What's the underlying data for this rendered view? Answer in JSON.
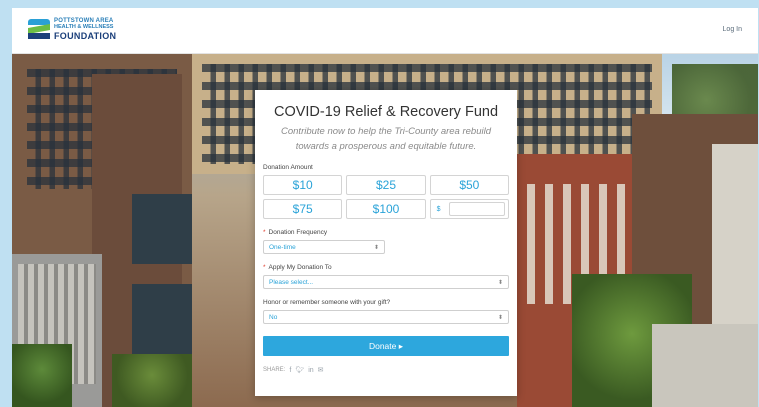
{
  "header": {
    "logo": {
      "line1": "POTTSTOWN AREA",
      "line2": "HEALTH & WELLNESS",
      "line3": "FOUNDATION"
    },
    "login_label": "Log In"
  },
  "form": {
    "title": "COVID-19 Relief & Recovery Fund",
    "subtitle_line1": "Contribute now to help the Tri-County area rebuild",
    "subtitle_line2": "towards a prosperous and equitable future.",
    "donation_amount_label": "Donation Amount",
    "amounts": [
      "$10",
      "$25",
      "$50",
      "$75",
      "$100"
    ],
    "custom_currency": "$",
    "frequency_label": "Donation Frequency",
    "frequency_value": "One-time",
    "apply_label": "Apply My Donation To",
    "apply_value": "Please select...",
    "honor_label": "Honor or remember someone with your gift?",
    "honor_value": "No",
    "donate_label": "Donate ▸",
    "share_label": "SHARE:"
  },
  "colors": {
    "accent": "#2da7dd",
    "required": "#e03b2b"
  },
  "icons": [
    "facebook-icon",
    "twitter-icon",
    "linkedin-icon",
    "email-icon"
  ]
}
